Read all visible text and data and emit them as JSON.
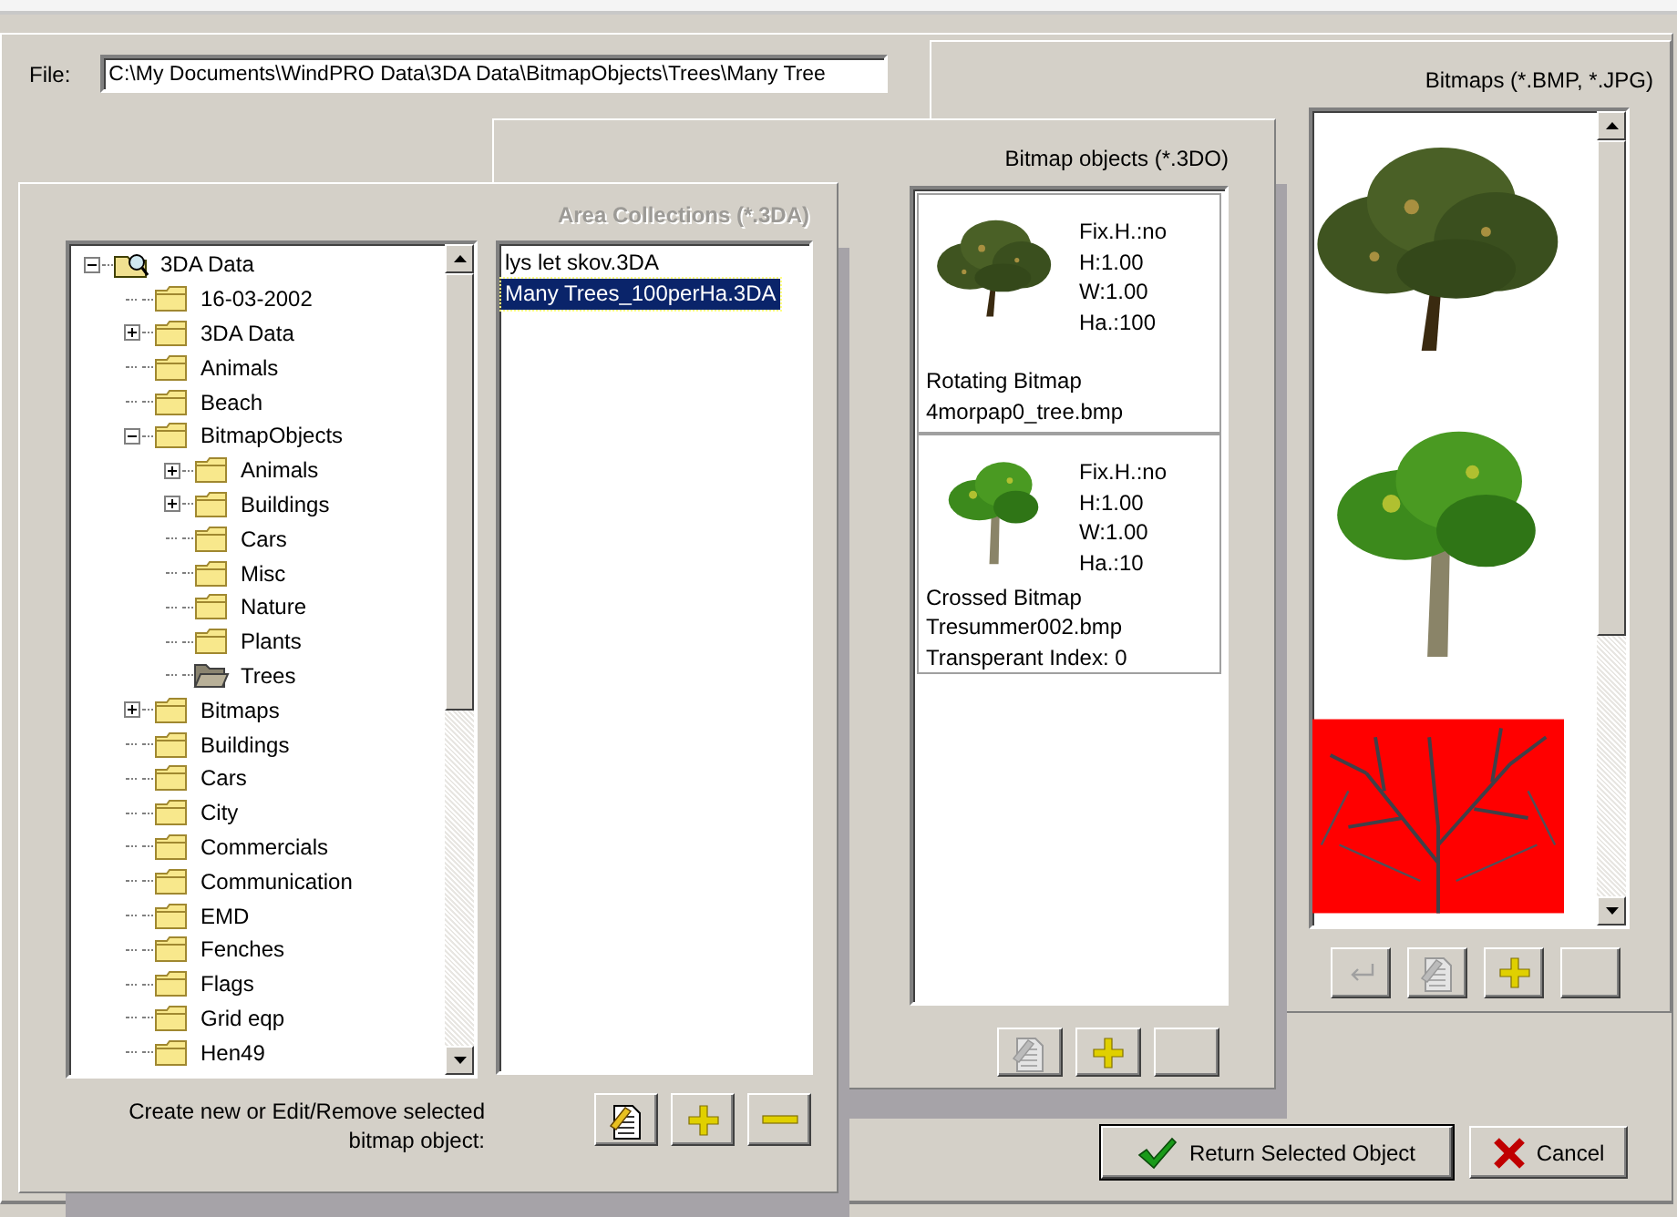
{
  "file": {
    "label": "File:",
    "value": "C:\\My Documents\\WindPRO Data\\3DA Data\\BitmapObjects\\Trees\\Many Tree"
  },
  "bitmaps_panel": {
    "title": "Bitmaps (*.BMP, *.JPG)",
    "active": true,
    "tools": [
      {
        "kind": "enter",
        "disabled": true
      },
      {
        "kind": "edit",
        "disabled": true
      },
      {
        "kind": "add",
        "disabled": false
      },
      {
        "kind": "blank"
      }
    ]
  },
  "objects_panel": {
    "title": "Bitmap objects (*.3DO)",
    "active": true,
    "cards": [
      {
        "specs": [
          "Fix.H.:no",
          "H:1.00",
          "W:1.00",
          "Ha.:100"
        ],
        "type": "Rotating Bitmap",
        "file": "4morpap0_tree.bmp"
      },
      {
        "specs": [
          "Fix.H.:no",
          "H:1.00",
          "W:1.00",
          "Ha.:10"
        ],
        "type": "Crossed Bitmap",
        "file": "Tresummer002.bmp",
        "index": "Transperant Index: 0"
      }
    ],
    "tools": [
      {
        "kind": "edit",
        "disabled": true
      },
      {
        "kind": "add",
        "disabled": false
      },
      {
        "kind": "blank"
      }
    ]
  },
  "area_panel": {
    "title": "Area Collections (*.3DA)",
    "active": false,
    "tree": [
      {
        "label": "3DA Data",
        "kind": "root",
        "expanded": true,
        "children": [
          {
            "label": "16-03-2002",
            "selected": false
          },
          {
            "label": "3DA Data",
            "selected": false,
            "expanded": false
          },
          {
            "label": "Animals",
            "selected": false
          },
          {
            "label": "Beach",
            "selected": false
          },
          {
            "label": "BitmapObjects",
            "selected": false,
            "expanded": true,
            "children": [
              {
                "label": "Animals",
                "selected": false,
                "expanded": false
              },
              {
                "label": "Buildings",
                "selected": false,
                "expanded": false
              },
              {
                "label": "Cars",
                "selected": false
              },
              {
                "label": "Misc",
                "selected": false
              },
              {
                "label": "Nature",
                "selected": false
              },
              {
                "label": "Plants",
                "selected": false
              },
              {
                "label": "Trees",
                "selected": true
              }
            ]
          },
          {
            "label": "Bitmaps",
            "selected": false,
            "expanded": false
          },
          {
            "label": "Buildings",
            "selected": false
          },
          {
            "label": "Cars",
            "selected": false
          },
          {
            "label": "City",
            "selected": false
          },
          {
            "label": "Commercials",
            "selected": false
          },
          {
            "label": "Communication",
            "selected": false
          },
          {
            "label": "EMD",
            "selected": false
          },
          {
            "label": "Fenches",
            "selected": false
          },
          {
            "label": "Flags",
            "selected": false
          },
          {
            "label": "Grid eqp",
            "selected": false
          },
          {
            "label": "Hen49",
            "selected": false
          }
        ]
      }
    ],
    "collections": [
      {
        "label": "lys let skov.3DA",
        "selected": false
      },
      {
        "label": "Many Trees_100perHa.3DA",
        "selected": true
      }
    ],
    "hint": "Create new or Edit/Remove selected bitmap object:",
    "tools": [
      {
        "kind": "edit",
        "disabled": false
      },
      {
        "kind": "add",
        "disabled": false
      },
      {
        "kind": "remove",
        "disabled": false
      }
    ]
  },
  "buttons": [
    {
      "kind": "ok",
      "label": "Return Selected Object",
      "default": true
    },
    {
      "kind": "cancel",
      "label": "Cancel",
      "default": false
    }
  ]
}
